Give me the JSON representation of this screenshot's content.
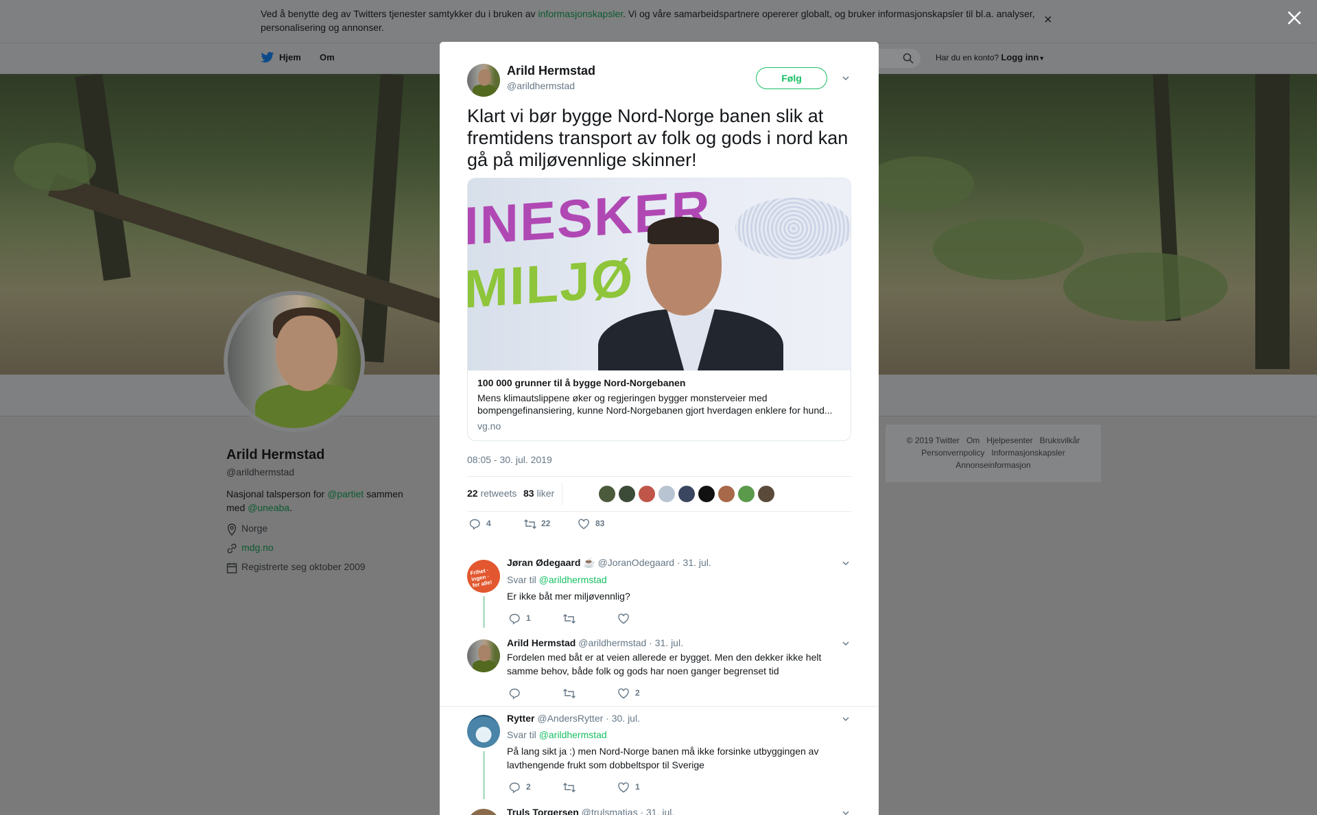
{
  "cookie": {
    "text_before": "Ved å benytte deg av Twitters tjenester samtykker du i bruken av ",
    "link": "informasjonskapsler",
    "text_after": ". Vi og våre samarbeidspartnere opererer globalt, og bruker informasjonskapsler til bl.a. analyser, personalisering og annonser.",
    "close": "×"
  },
  "nav": {
    "home": "Hjem",
    "about": "Om",
    "account_prompt": "Har du en konto?",
    "login": "Logg inn"
  },
  "profile": {
    "name": "Arild Hermstad",
    "handle": "@arildhermstad",
    "bio_before": "Nasjonal talsperson for ",
    "bio_link1": "@partiet",
    "bio_mid": " sammen med ",
    "bio_link2": "@uneaba",
    "bio_after": ".",
    "location": "Norge",
    "website": "mdg.no",
    "joined": "Registrerte seg oktober 2009"
  },
  "footer": {
    "line1": "© 2019 Twitter   Om   Hjelpesenter   Bruksvilkår",
    "line2": "Personvernpolicy   Informasjonskapsler",
    "line3": "Annonseinformasjon"
  },
  "tweet": {
    "name": "Arild Hermstad",
    "handle": "@arildhermstad",
    "follow": "Følg",
    "text": "Klart vi bør bygge Nord-Norge banen slik at fremtidens transport av folk og gods i nord kan gå på miljøvennlige skinner!",
    "card": {
      "image_text1": "INESKER",
      "image_text2": "MILJØ",
      "title": "100 000 grunner til å bygge Nord-Norgebanen",
      "description": "Mens klimautslippene øker og regjeringen bygger monsterveier med bompengefinansiering, kunne Nord-Norgebanen gjort hverdagen enklere for hund...",
      "domain": "vg.no"
    },
    "timestamp": "08:05 - 30. jul. 2019",
    "retweets_count": "22",
    "retweets_label": "retweets",
    "likes_count": "83",
    "likes_label": "liker",
    "replies": "4",
    "retweets": "22",
    "likes": "83"
  },
  "replies": [
    {
      "name": "Jøran Ødegaard ☕",
      "handle": "@JoranOdegaard",
      "date": "· 31. jul.",
      "reply_to_label": "Svar til",
      "reply_to": "@arildhermstad",
      "text": "Er ikke båt mer miljøvennlig?",
      "replies": "1",
      "retweets": "",
      "likes": ""
    },
    {
      "name": "Arild Hermstad",
      "handle": "@arildhermstad",
      "date": "· 31. jul.",
      "text": "Fordelen med båt er at veien allerede er bygget. Men den dekker ikke helt samme behov, både folk og gods har noen ganger begrenset tid",
      "replies": "",
      "retweets": "",
      "likes": "2"
    },
    {
      "name": "Rytter",
      "handle": "@AndersRytter",
      "date": "· 30. jul.",
      "reply_to_label": "Svar til",
      "reply_to": "@arildhermstad",
      "text": "På lang sikt ja :) men Nord-Norge banen må ikke forsinke utbyggingen av lavthengende frukt som dobbeltspor til Sverige",
      "replies": "2",
      "retweets": "",
      "likes": "1"
    },
    {
      "name": "Truls Torgersen",
      "handle": "@trulsmatias",
      "date": "· 31. jul."
    }
  ],
  "colors": {
    "accent": "#17bf63",
    "muted": "#657786",
    "text": "#14171a"
  }
}
